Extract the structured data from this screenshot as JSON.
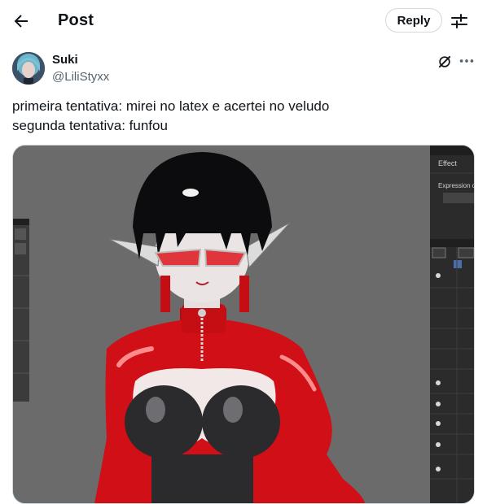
{
  "header": {
    "back_icon": "arrow-left-icon",
    "title": "Post",
    "reply_label": "Reply",
    "tune_icon": "sliders-icon"
  },
  "post": {
    "author_name": "Suki",
    "author_handle": "@LiliStyxx",
    "grok_icon": "grok-icon",
    "more_icon": "more-horizontal-icon",
    "text_lines": [
      "primeira tentativa: mirei no latex e acertei no veludo",
      "segunda tentativa: funfou"
    ],
    "media": {
      "panel_label_effect": "Effect",
      "panel_label_expression": "Expression c"
    }
  },
  "colors": {
    "text": "#0f1419",
    "muted": "#536471",
    "border": "#cfd9de",
    "latex_red": "#d10f16"
  }
}
